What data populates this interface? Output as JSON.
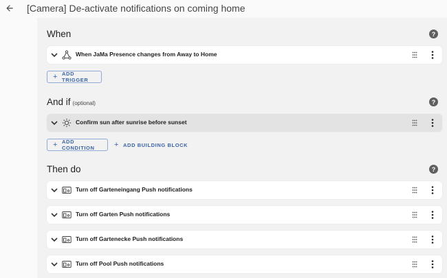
{
  "header": {
    "title": "[Camera] De-activate notifications on coming home",
    "back_icon": "arrow-left-icon"
  },
  "colors": {
    "accent": "#3a64a6",
    "page_bg": "#f2f2f2",
    "card_bg": "#ffffff",
    "highlight_bg": "#e3e3e3",
    "help_icon": "#5f5f5f"
  },
  "when": {
    "title": "When",
    "help_icon": "help-icon",
    "triggers": [
      {
        "label": "When JaMa Presence changes from Away to Home",
        "icon": "state-change-icon"
      }
    ],
    "add_trigger_label": "ADD TRIGGER"
  },
  "and_if": {
    "title": "And if",
    "subtitle": "(optional)",
    "help_icon": "help-icon",
    "conditions": [
      {
        "label": "Confirm sun after sunrise before sunset",
        "icon": "sun-icon"
      }
    ],
    "add_condition_label": "ADD CONDITION",
    "add_building_block_label": "ADD BUILDING BLOCK"
  },
  "then_do": {
    "title": "Then do",
    "help_icon": "help-icon",
    "actions": [
      {
        "label": "Turn off Garteneingang Push notifications",
        "icon": "device-icon"
      },
      {
        "label": "Turn off Garten Push notifications",
        "icon": "device-icon"
      },
      {
        "label": "Turn off Gartenecke Push notifications",
        "icon": "device-icon"
      },
      {
        "label": "Turn off Pool Push notifications",
        "icon": "device-icon"
      }
    ]
  }
}
